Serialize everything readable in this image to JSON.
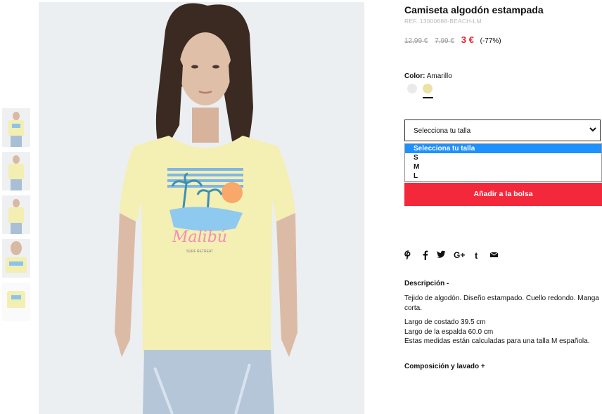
{
  "product": {
    "title": "Camiseta algodón estampada",
    "ref": "REF. 13000688-BEACH-LM",
    "price_original": "12,99 €",
    "price_previous": "7,99 €",
    "price_current": "3 €",
    "discount": "(-77%)"
  },
  "color": {
    "label": "Color:",
    "selected": "Amarillo",
    "swatches": [
      "#eaeaea",
      "#ebe3a6"
    ]
  },
  "size": {
    "placeholder": "Selecciona tu talla",
    "options": [
      "Selecciona tu talla",
      "S",
      "M",
      "L"
    ]
  },
  "add_to_bag": "Añadir a la bolsa",
  "social_icons": [
    "pinterest-icon",
    "facebook-icon",
    "twitter-icon",
    "google-plus-icon",
    "tumblr-icon",
    "email-icon"
  ],
  "description": {
    "heading": "Descripción -",
    "lines": [
      "Tejido de algodón. Diseño estampado. Cuello redondo. Manga corta.",
      "Largo de costado 39.5 cm",
      "Largo de la espalda 60.0 cm",
      "Estas medidas están calculadas para una talla M española."
    ]
  },
  "composition_heading": "Composición y lavado +",
  "image": {
    "print_text": "Malibú",
    "print_subtext": "SURF RETREAT"
  }
}
